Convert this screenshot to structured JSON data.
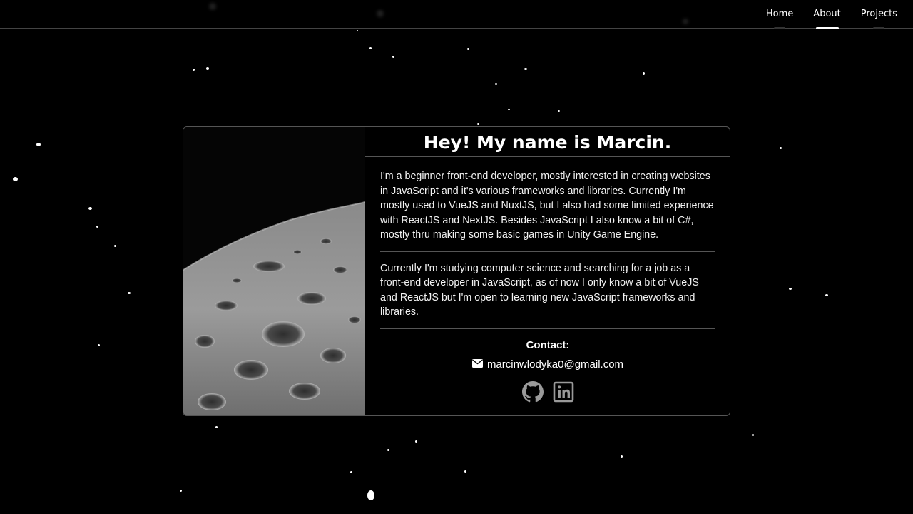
{
  "nav": {
    "links": [
      {
        "label": "Home",
        "active": false
      },
      {
        "label": "About",
        "active": true
      },
      {
        "label": "Projects",
        "active": false
      }
    ]
  },
  "about": {
    "title": "Hey! My name is Marcin.",
    "paragraph1": "I'm a beginner front-end developer, mostly interested in creating websites in JavaScript and it's various frameworks and libraries. Currently I'm mostly used to VueJS and NuxtJS, but I also had some limited experience with ReactJS and NextJS. Besides JavaScript I also know a bit of C#, mostly thru making some basic games in Unity Game Engine.",
    "paragraph2": "Currently I'm studying computer science and searching for a job as a front-end developer in JavaScript, as of now I only know a bit of VueJS and ReactJS but I'm open to learning new JavaScript frameworks and libraries.",
    "contact_label": "Contact:",
    "email": "marcinwlodyka0@gmail.com",
    "icons": {
      "email": "envelope-icon",
      "github": "github-icon",
      "linkedin": "linkedin-icon"
    }
  },
  "colors": {
    "background": "#000000",
    "text": "#ffffff",
    "border": "#555555",
    "icon": "#9a9a9a"
  }
}
